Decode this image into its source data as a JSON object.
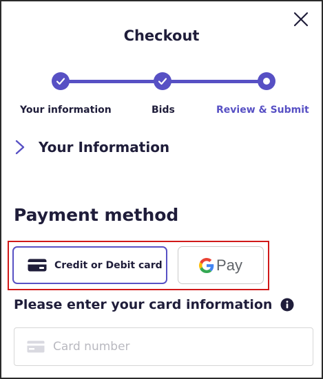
{
  "header": {
    "title": "Checkout"
  },
  "steps": [
    {
      "label": "Your information",
      "state": "done"
    },
    {
      "label": "Bids",
      "state": "done"
    },
    {
      "label": "Review & Submit",
      "state": "current"
    }
  ],
  "section": {
    "label": "Your Information"
  },
  "payment": {
    "title": "Payment method",
    "card_option": "Credit or Debit card",
    "gpay_option": "Pay",
    "card_info_title": "Please enter your card information",
    "card_number_placeholder": "Card number"
  },
  "colors": {
    "accent": "#5750c4",
    "text": "#1f1d3a",
    "highlight": "#d01818"
  },
  "icons": [
    "close-icon",
    "check-icon",
    "chevron-right-icon",
    "credit-card-icon",
    "google-g-icon",
    "info-icon",
    "card-placeholder-icon"
  ]
}
